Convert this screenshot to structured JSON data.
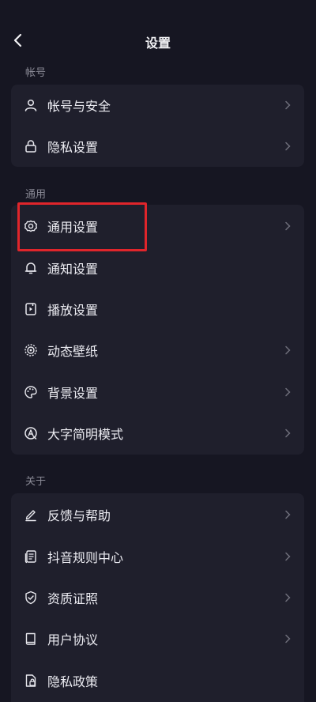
{
  "header": {
    "title": "设置"
  },
  "sections": [
    {
      "label": "帐号",
      "items": [
        {
          "label": "帐号与安全",
          "icon": "user-icon",
          "chevron": true
        },
        {
          "label": "隐私设置",
          "icon": "lock-icon",
          "chevron": true
        }
      ]
    },
    {
      "label": "通用",
      "items": [
        {
          "label": "通用设置",
          "icon": "gear-icon",
          "chevron": true
        },
        {
          "label": "通知设置",
          "icon": "bell-icon",
          "chevron": false
        },
        {
          "label": "播放设置",
          "icon": "play-device-icon",
          "chevron": false
        },
        {
          "label": "动态壁纸",
          "icon": "dynamic-wallpaper-icon",
          "chevron": true
        },
        {
          "label": "背景设置",
          "icon": "palette-icon",
          "chevron": true
        },
        {
          "label": "大字简明模式",
          "icon": "large-text-icon",
          "chevron": true
        }
      ]
    },
    {
      "label": "关于",
      "items": [
        {
          "label": "反馈与帮助",
          "icon": "pen-icon",
          "chevron": true
        },
        {
          "label": "抖音规则中心",
          "icon": "rules-document-icon",
          "chevron": true
        },
        {
          "label": "资质证照",
          "icon": "shield-check-icon",
          "chevron": true
        },
        {
          "label": "用户协议",
          "icon": "book-icon",
          "chevron": true
        },
        {
          "label": "隐私政策",
          "icon": "privacy-document-icon",
          "chevron": false
        }
      ]
    }
  ],
  "colors": {
    "background": "#161622",
    "card": "#1f1f2c",
    "highlight": "#e0252b"
  }
}
